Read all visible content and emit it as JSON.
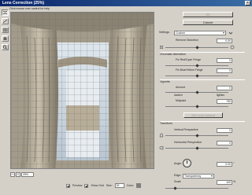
{
  "window": {
    "title": "Lens Correction (25%)",
    "close_glyph": "×"
  },
  "hint": "Click mouse over control for help",
  "tools": [
    "remove-distortion-tool",
    "straighten-tool",
    "move-grid-tool",
    "hand-tool",
    "zoom-tool"
  ],
  "zoom": {
    "minus": "−",
    "plus": "+",
    "value": "25%"
  },
  "bottom": {
    "preview_label": "Preview",
    "show_grid_label": "Show Grid",
    "size_label": "Size:",
    "size_value": "32",
    "color_label": "Color:",
    "grid_color": "#7f7f7f"
  },
  "buttons": {
    "ok": "OK",
    "cancel": "Cancel",
    "set_default": "Set Lens Default"
  },
  "settings": {
    "label": "Settings:",
    "value": "Custom"
  },
  "remove_distortion": {
    "label": "Remove Distortion",
    "value": "0.00"
  },
  "chromatic": {
    "title": "Chromatic Aberration",
    "red_cyan_label": "Fix Red/Cyan Fringe",
    "red_cyan_value": "0",
    "blue_yellow_label": "Fix Blue/Yellow Fringe",
    "blue_yellow_value": "0"
  },
  "vignette": {
    "title": "Vignette",
    "amount_label": "Amount",
    "amount_value": "0",
    "darken_label": "darken",
    "lighten_label": "lighten",
    "midpoint_label": "Midpoint",
    "midpoint_value": "+50"
  },
  "transform": {
    "title": "Transform",
    "vertical_label": "Vertical Perspective",
    "vertical_value": "0",
    "horizontal_label": "Horizontal Perspective",
    "horizontal_value": "0",
    "angle_label": "Angle:",
    "angle_value": "0.00",
    "angle_unit": "°",
    "edge_label": "Edge:",
    "edge_value": "Transparency",
    "scale_label": "Scale",
    "scale_value": "100",
    "scale_unit": "%"
  }
}
